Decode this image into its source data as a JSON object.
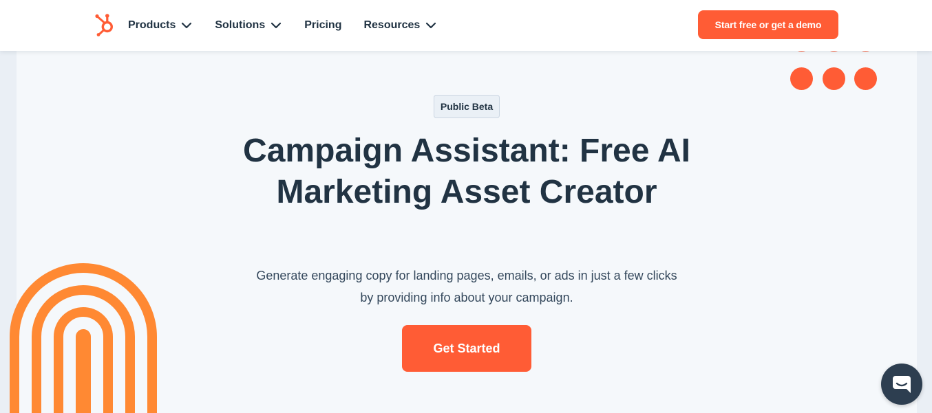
{
  "nav": {
    "items": [
      {
        "label": "Products",
        "has_dropdown": true
      },
      {
        "label": "Solutions",
        "has_dropdown": true
      },
      {
        "label": "Pricing",
        "has_dropdown": false
      },
      {
        "label": "Resources",
        "has_dropdown": true
      }
    ],
    "cta_label": "Start free or get a demo"
  },
  "hero": {
    "badge": "Public Beta",
    "title": "Campaign Assistant: Free AI Marketing Asset Creator",
    "subtitle": "Generate engaging copy for landing pages, emails, or ads in just a few clicks by providing info about your campaign.",
    "cta_label": "Get Started"
  },
  "icons": {
    "logo": "hubspot-sprocket-icon",
    "dropdown": "chevron-down-icon",
    "chat": "chat-bubble-icon"
  },
  "colors": {
    "accent": "#ff5c35",
    "arch": "#ff8933",
    "heading": "#213343",
    "hero_bg": "#f5f8fb",
    "chat_bg": "#2d3e50"
  }
}
